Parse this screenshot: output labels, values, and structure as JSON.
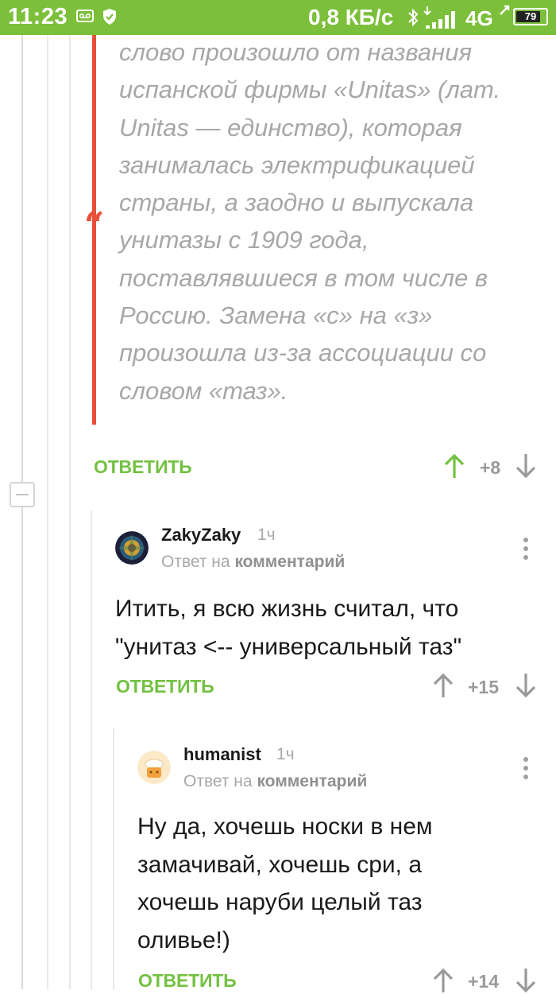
{
  "status_bar": {
    "time": "11:23",
    "speed": "0,8 КБ/с",
    "network": "4G",
    "battery": "79"
  },
  "quote": {
    "text": "слово произошло от названия испанской фирмы «Unitas» (лат. Unitas — единство), которая занималась электрификацией страны, а заодно и выпускала унитазы с 1909 года, поставлявшиеся в том числе в Россию. Замена «с» на «з» произошла из-за ассоциации со словом «таз».",
    "reply_label": "ОТВЕТИТЬ",
    "rating": "+8"
  },
  "comments": [
    {
      "username": "ZakyZaky",
      "time": "1ч",
      "reply_prefix": "Ответ на",
      "reply_target": "комментарий",
      "text": "Итить, я всю жизнь считал, что \"унитаз <-- универсальный таз\"",
      "reply_label": "ОТВЕТИТЬ",
      "rating": "+15"
    },
    {
      "username": "humanist",
      "time": "1ч",
      "reply_prefix": "Ответ на",
      "reply_target": "комментарий",
      "text": "Ну да, хочешь носки в нем замачивай, хочешь сри, а хочешь наруби целый таз оливье!)",
      "reply_label": "ОТВЕТИТЬ",
      "rating": "+14"
    }
  ],
  "colors": {
    "status_bar": "#7cbf3a",
    "accent_green": "#73c142",
    "quote_bar": "#e8503a"
  },
  "icons": {
    "upvote": "arrow-up-icon",
    "downvote": "arrow-down-icon",
    "menu": "kebab-menu-icon",
    "collapse": "collapse-minus-icon"
  }
}
